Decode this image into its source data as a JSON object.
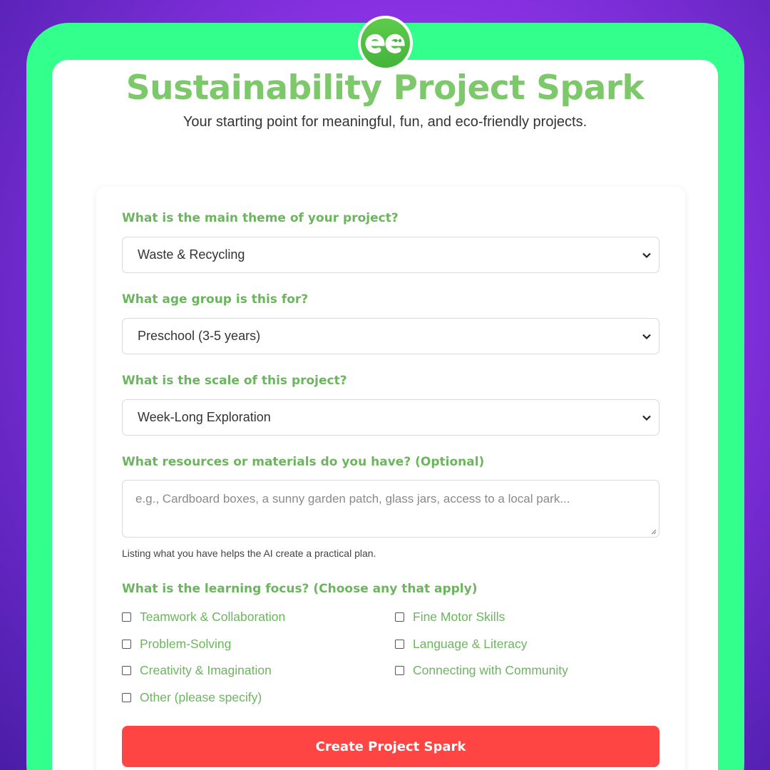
{
  "header": {
    "title": "Sustainability Project Spark",
    "subtitle": "Your starting point for meaningful, fun, and eco-friendly projects."
  },
  "form": {
    "theme": {
      "label": "What is the main theme of your project?",
      "value": "Waste & Recycling"
    },
    "age": {
      "label": "What age group is this for?",
      "value": "Preschool (3-5 years)"
    },
    "scale": {
      "label": "What is the scale of this project?",
      "value": "Week-Long Exploration"
    },
    "resources": {
      "label": "What resources or materials do you have? (Optional)",
      "placeholder": "e.g., Cardboard boxes, a sunny garden patch, glass jars, access to a local park...",
      "help": "Listing what you have helps the AI create a practical plan."
    },
    "focus": {
      "label": "What is the learning focus? (Choose any that apply)",
      "options": [
        "Teamwork & Collaboration",
        "Fine Motor Skills",
        "Problem-Solving",
        "Language & Literacy",
        "Creativity & Imagination",
        "Connecting with Community",
        "Other (please specify)"
      ]
    },
    "submit_label": "Create Project Spark"
  },
  "colors": {
    "accent_green": "#6cb55e",
    "title_green": "#7dc86a",
    "frame_green": "#33ff8c",
    "button_red": "#ff4444",
    "background_purple": "#8f33e8"
  },
  "icons": {
    "logo": "ee-logo-icon",
    "select": "chevron-down-icon",
    "textarea": "resize-handle-icon"
  }
}
